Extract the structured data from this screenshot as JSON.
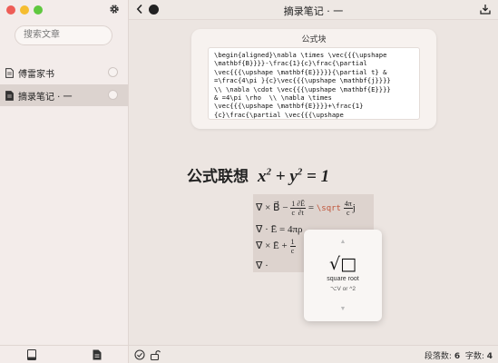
{
  "sidebar": {
    "search_placeholder": "搜索文章",
    "files": [
      {
        "label": "傅雷家书"
      },
      {
        "label": "摘录笔记 · 一"
      }
    ]
  },
  "topbar": {
    "title": "摘录笔记  ·  一"
  },
  "formula_block": {
    "title": "公式块",
    "code": "\\begin{aligned}\\nabla \\times \\vec{{{\\upshape\n\\mathbf{B}}}}-\\frac{1}{c}\\frac{\\partial\n\\vec{{{\\upshape \\mathbf{E}}}}}{\\partial t} &\n=\\frac{4\\pi }{c}\\vec{{{\\upshape \\mathbf{j}}}}\n\\\\ \\nabla \\cdot \\vec{{{\\upshape \\mathbf{E}}}}\n& =4\\pi \\rho  \\\\ \\nabla \\times\n\\vec{{{\\upshape \\mathbf{E}}}}+\\frac{1}\n{c}\\frac{\\partial \\vec{{{\\upshape"
  },
  "heading": {
    "text": "公式联想",
    "eq_base_x": "x",
    "eq_exp": "2",
    "eq_plus": " + ",
    "eq_base_y": "y",
    "eq_rest": " = 1"
  },
  "math_preview": {
    "line1_pre": "∇ × B⃗ − ",
    "frac1_num": "1",
    "frac1_den": "c",
    "frac2_num": "∂Ē",
    "frac2_den": "∂t",
    "eq": " = ",
    "cmd": "\\sqrt",
    "frac3_num": "4π",
    "frac3_den": "c",
    "tail": "j",
    "line2": "∇ · Ē = 4πρ",
    "line3_pre": "∇ × Ē + ",
    "frac4_num": "1",
    "frac4_den": "c",
    "line4": "∇ ·"
  },
  "autocomplete": {
    "symbol": "√□",
    "name": "square root",
    "shortcut": "⌥V or ^2",
    "up": "▲",
    "down": "▼"
  },
  "statusbar": {
    "paragraphs_label": "段落数: ",
    "paragraphs_value": "6",
    "words_label": "字数: ",
    "words_value": "4"
  },
  "colors": {
    "sidebar_bg": "#f3ecea",
    "main_bg": "#ece5e1",
    "active_item": "#dcd3cf",
    "latex_cmd": "#c0553a"
  }
}
